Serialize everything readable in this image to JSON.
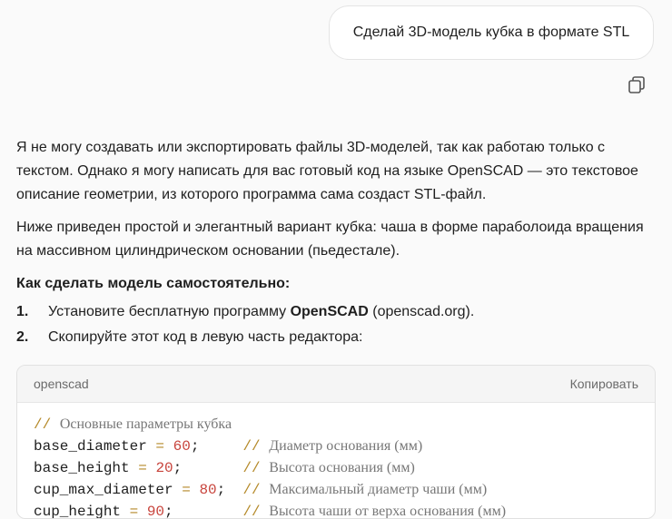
{
  "user_message": "Сделай 3D-модель кубка в формате STL",
  "answer": {
    "para1": "Я не могу создавать или экспортировать файлы 3D-моделей, так как работаю только с текстом. Однако я могу написать для вас готовый код на языке OpenSCAD — это текстовое описание геометрии, из которого программа сама создаст STL-файл.",
    "para2": "Ниже приведен простой и элегантный вариант кубка: чаша в форме параболоида вращения на массивном цилиндрическом основании (пьедестале).",
    "howto_heading": "Как сделать модель самостоятельно:",
    "steps": [
      {
        "num": "1.",
        "before": "Установите бесплатную программу ",
        "bold": "OpenSCAD",
        "after": " (openscad.org)."
      },
      {
        "num": "2.",
        "before": "Скопируйте этот код в левую часть редактора:",
        "bold": "",
        "after": ""
      }
    ]
  },
  "code": {
    "language": "openscad",
    "copy_label": "Копировать",
    "comment_header": "Основные параметры кубка",
    "lines": [
      {
        "name": "base_diameter",
        "value": "60",
        "comment": "Диаметр основания (мм)"
      },
      {
        "name": "base_height",
        "value": "20",
        "comment": "Высота основания (мм)"
      },
      {
        "name": "cup_max_diameter",
        "value": "80",
        "comment": "Максимальный диаметр чаши (мм)"
      },
      {
        "name": "cup_height",
        "value": "90",
        "comment": "Высота чаши от верха основания (мм)"
      }
    ]
  },
  "colors": {
    "page_bg": "#fafafa",
    "comment": "#777777",
    "number": "#c8443c",
    "operator": "#b58a2a"
  },
  "icons": {
    "copy_message": "copy-icon"
  }
}
